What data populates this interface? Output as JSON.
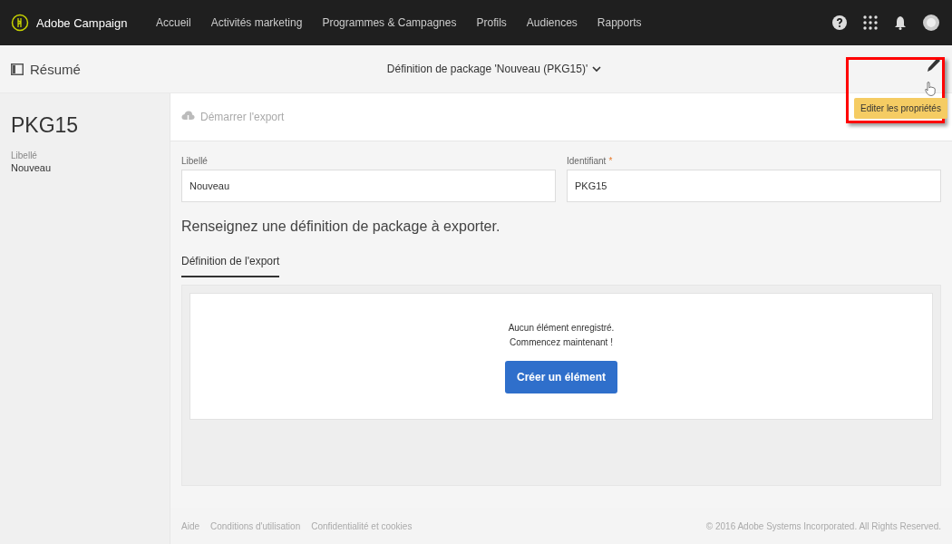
{
  "app": {
    "name": "Adobe Campaign"
  },
  "nav": [
    {
      "label": "Accueil"
    },
    {
      "label": "Activités marketing"
    },
    {
      "label": "Programmes & Campagnes"
    },
    {
      "label": "Profils"
    },
    {
      "label": "Audiences"
    },
    {
      "label": "Rapports"
    }
  ],
  "subheader": {
    "summary": "Résumé",
    "title": "Définition de package 'Nouveau (PKG15)'",
    "tooltip": "Editer les propriétés"
  },
  "sidebar": {
    "title": "PKG15",
    "field_label": "Libellé",
    "field_value": "Nouveau"
  },
  "action": {
    "label": "Démarrer l'export",
    "disabled": true
  },
  "fields": [
    {
      "label": "Libellé",
      "value": "Nouveau"
    },
    {
      "label": "Identifiant",
      "value": "PKG15",
      "required_mark": "*"
    }
  ],
  "heading": "Renseignez une définition de package à exporter.",
  "tabs": [
    {
      "label": "Définition de l'export",
      "selected": true
    }
  ],
  "empty_state": {
    "line_1": "Aucun élément enregistré.",
    "line_2": "Commencez maintenant !",
    "button": "Créer un élément"
  },
  "footer": {
    "links": [
      "Aide",
      "Conditions d'utilisation",
      "Confidentialité et cookies"
    ],
    "copyright": "© 2016 Adobe Systems Incorporated. All Rights Reserved."
  }
}
